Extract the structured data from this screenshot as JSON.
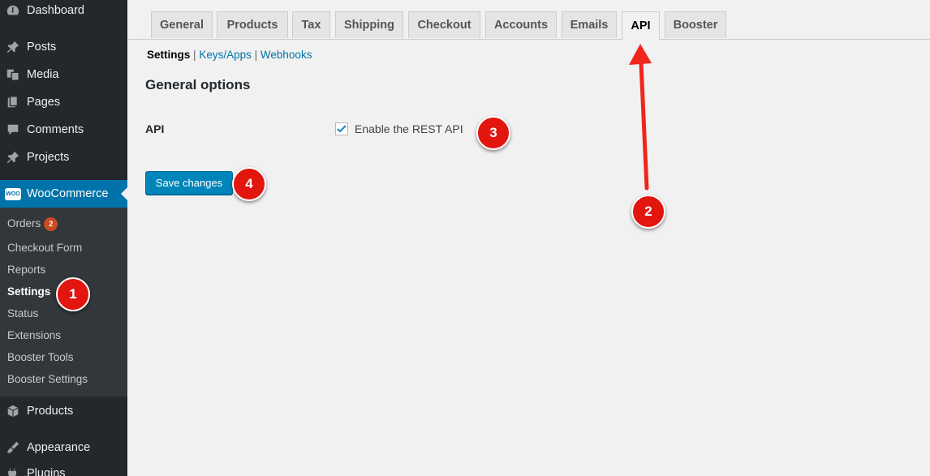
{
  "admin_menu": {
    "items": [
      {
        "label": "Dashboard",
        "icon": "dashboard-icon"
      },
      {
        "label": "Posts",
        "icon": "pin-icon"
      },
      {
        "label": "Media",
        "icon": "media-icon"
      },
      {
        "label": "Pages",
        "icon": "pages-icon"
      },
      {
        "label": "Comments",
        "icon": "comment-icon"
      },
      {
        "label": "Projects",
        "icon": "pin-icon"
      },
      {
        "label": "WooCommerce",
        "icon": "woocommerce-icon",
        "logo_text": "WOO"
      },
      {
        "label": "Products",
        "icon": "box-icon"
      },
      {
        "label": "Appearance",
        "icon": "brush-icon"
      },
      {
        "label": "Plugins",
        "icon": "plug-icon"
      }
    ],
    "woocommerce_submenu": [
      {
        "label": "Orders",
        "badge": "2"
      },
      {
        "label": "Checkout Form"
      },
      {
        "label": "Reports"
      },
      {
        "label": "Settings"
      },
      {
        "label": "Status"
      },
      {
        "label": "Extensions"
      },
      {
        "label": "Booster Tools"
      },
      {
        "label": "Booster Settings"
      }
    ]
  },
  "tabs": [
    "General",
    "Products",
    "Tax",
    "Shipping",
    "Checkout",
    "Accounts",
    "Emails",
    "API",
    "Booster"
  ],
  "active_tab": "API",
  "subnav": {
    "current": "Settings",
    "links": [
      "Keys/Apps",
      "Webhooks"
    ],
    "separator": "|"
  },
  "section_title": "General options",
  "api_setting": {
    "label": "API",
    "checkbox_label": "Enable the REST API",
    "checked": true
  },
  "save_button": "Save changes",
  "markers": [
    "1",
    "2",
    "3",
    "4"
  ],
  "colors": {
    "sidebar_bg": "#23282d",
    "submenu_bg": "#32373c",
    "active_menu": "#0073aa",
    "button_blue": "#0085ba",
    "marker_red": "#e3150f",
    "arrow_red": "#f0261d",
    "badge_orange": "#ca4a1f"
  }
}
